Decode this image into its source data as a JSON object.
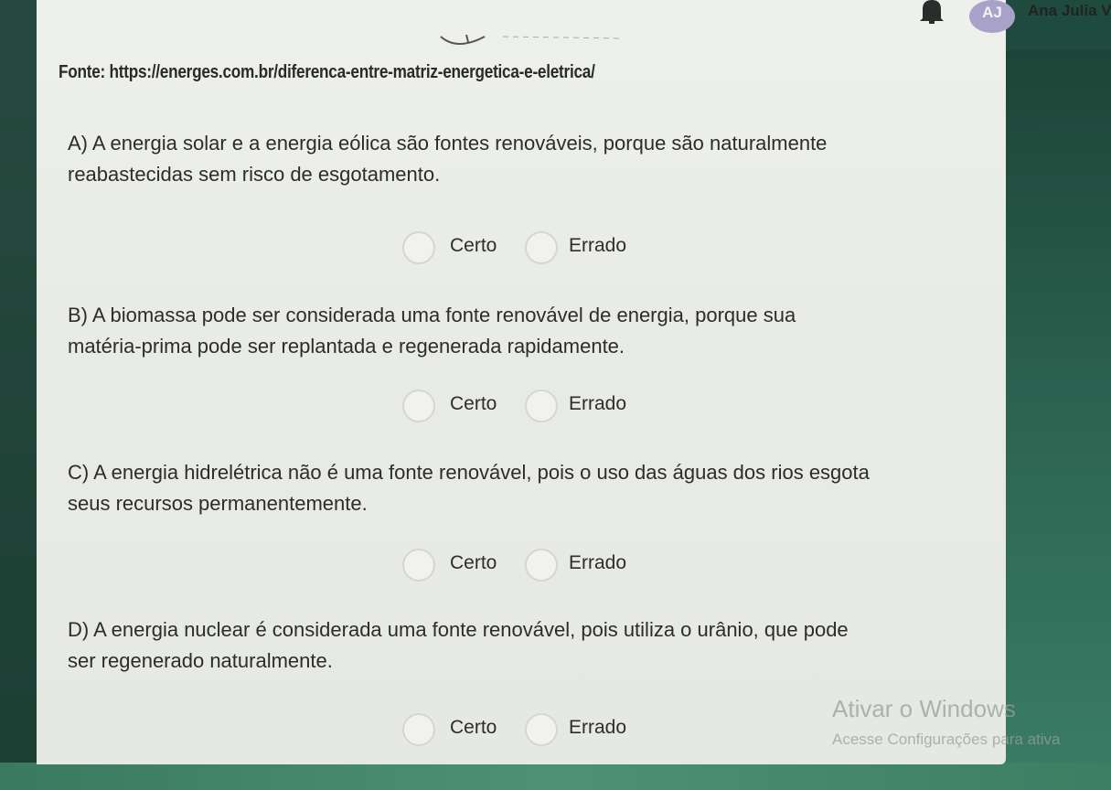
{
  "header": {
    "avatar_initials": "AJ",
    "user_name": "Ana Julia V",
    "bell_icon": "bell-icon"
  },
  "source_text": "Fonte: https://energes.com.br/diferenca-entre-matriz-energetica-e-eletrica/",
  "questions": [
    {
      "lines": [
        "A) A energia solar e a energia eólica são fontes renováveis, porque são naturalmente",
        "reabastecidas sem risco de esgotamento."
      ],
      "option_true": "Certo",
      "option_false": "Errado"
    },
    {
      "lines": [
        "B) A biomassa pode ser considerada uma fonte renovável de energia, porque sua",
        "matéria-prima pode ser replantada e regenerada rapidamente."
      ],
      "option_true": "Certo",
      "option_false": "Errado"
    },
    {
      "lines": [
        "C) A energia hidrelétrica não é uma fonte renovável, pois o uso das águas dos rios esgota",
        "seus recursos permanentemente."
      ],
      "option_true": "Certo",
      "option_false": "Errado"
    },
    {
      "lines": [
        "D) A energia nuclear é considerada uma fonte renovável, pois utiliza o urânio, que pode",
        "ser regenerado naturalmente."
      ],
      "option_true": "Certo",
      "option_false": "Errado"
    }
  ],
  "watermark": {
    "title": "Ativar o Windows",
    "subtitle": "Acesse Configurações para ativa"
  },
  "colors": {
    "background_green": "#1f4a3e",
    "card": "#eceeea",
    "avatar": "#a9a2c8"
  }
}
